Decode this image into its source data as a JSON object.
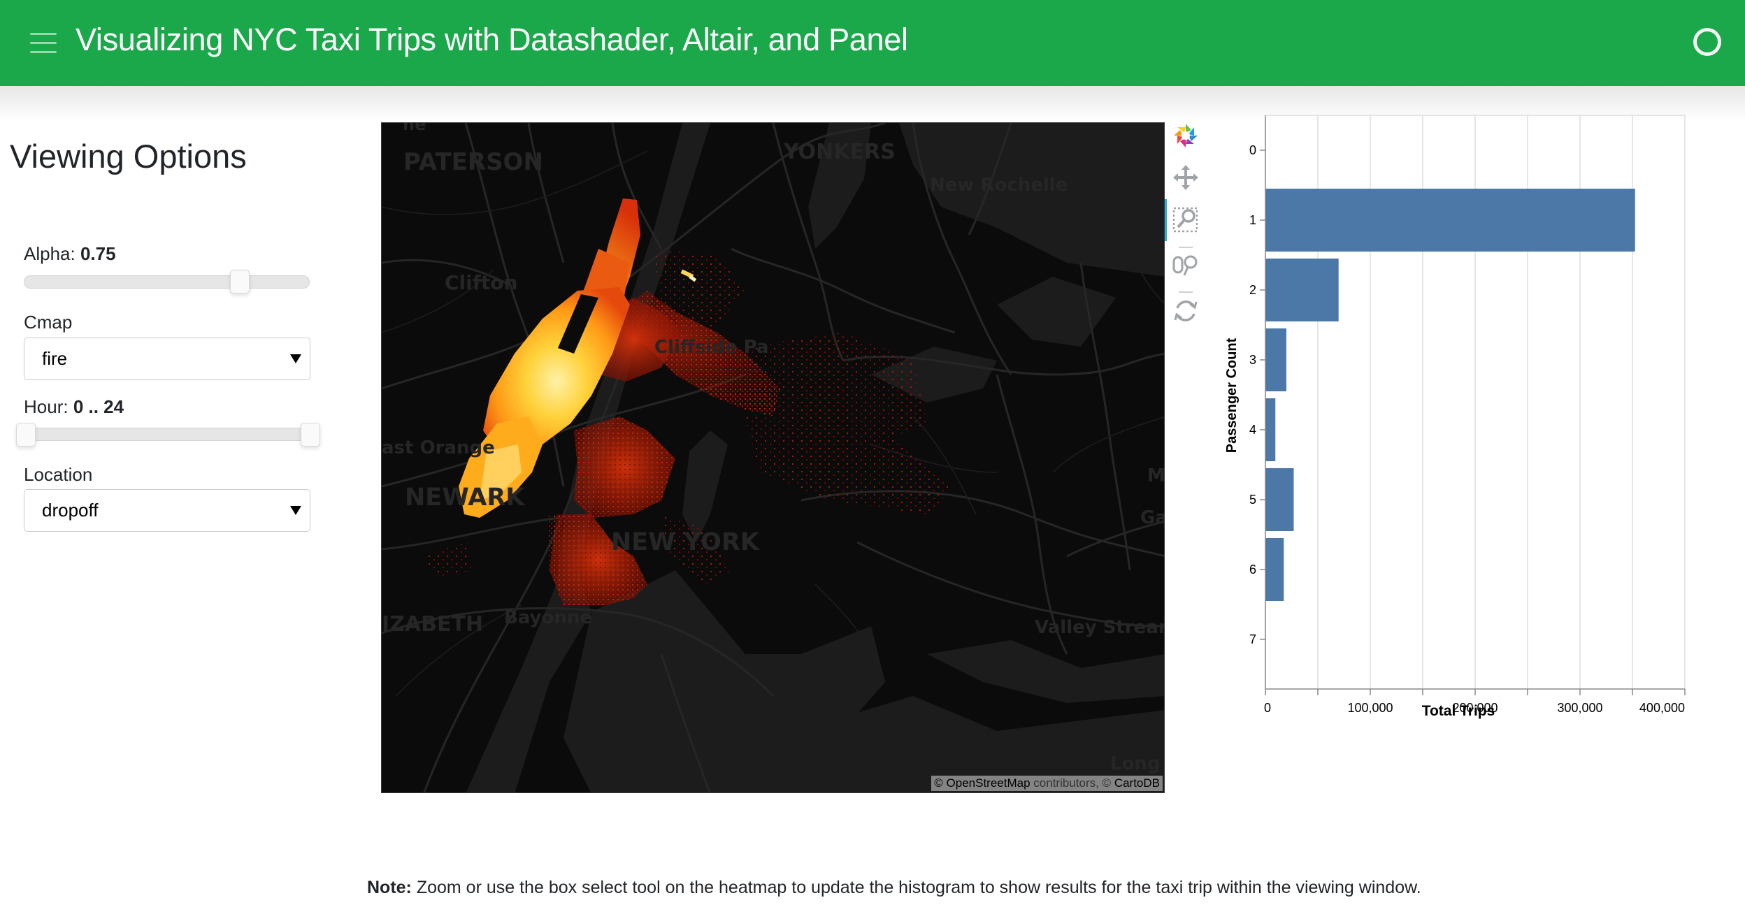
{
  "header": {
    "title": "Visualizing NYC Taxi Trips with Datashader, Altair, and Panel",
    "menu_icon": "hamburger-icon",
    "status_icon": "busy-indicator-circle",
    "color": "#1aa84a"
  },
  "sidebar": {
    "title": "Viewing Options",
    "alpha": {
      "label": "Alpha:",
      "value": "0.75",
      "fraction": 0.75,
      "min": 0,
      "max": 1
    },
    "cmap": {
      "label": "Cmap",
      "value": "fire"
    },
    "hour": {
      "label": "Hour:",
      "value": "0 .. 24",
      "start": 0,
      "end": 24,
      "min": 0,
      "max": 24
    },
    "location": {
      "label": "Location",
      "value": "dropoff"
    }
  },
  "map": {
    "labels": {
      "paterson": "PATERSON",
      "yonkers": "YONKERS",
      "new_rochelle": "New Rochelle",
      "clifton": "Clifton",
      "cliffside": "Cliffside Pa",
      "east_orange": "ast Orange",
      "newark": "NEWARK",
      "new_york": "NEW YORK",
      "elizabeth": "IZABETH",
      "bayonne": "Bayonne",
      "valley_stream": "Valley Stream",
      "long_beach": "Long B",
      "m_label": "M",
      "ga_label": "Ga",
      "top_label": "ne"
    },
    "attribution": {
      "prefix": "©",
      "osm": "OpenStreetMap",
      "contributors": "contributors, ©",
      "carto": "CartoDB"
    },
    "toolbar": [
      {
        "name": "bokeh-logo-icon"
      },
      {
        "name": "pan-icon"
      },
      {
        "name": "box-zoom-icon",
        "active": true
      },
      {
        "name": "wheel-zoom-icon"
      },
      {
        "name": "reset-icon"
      }
    ]
  },
  "chart_data": {
    "type": "bar",
    "orientation": "horizontal",
    "title": "",
    "xlabel": "Total Trips",
    "ylabel": "Passenger Count",
    "categories": [
      "0",
      "1",
      "2",
      "3",
      "4",
      "5",
      "6",
      "7"
    ],
    "values": [
      0,
      352500,
      69800,
      20000,
      9500,
      27000,
      17500,
      0
    ],
    "xlim": [
      0,
      400000
    ],
    "xticks": [
      "0",
      "100,000",
      "200,000",
      "300,000",
      "400,000"
    ],
    "xtick_values": [
      0,
      100000,
      200000,
      300000,
      400000
    ],
    "grid_step": 50000,
    "grid": true,
    "bar_color": "#4c78a8"
  },
  "note": {
    "bold": "Note:",
    "text": " Zoom or use the box select tool on the heatmap to update the histogram to show results for the taxi trip within the viewing window."
  }
}
